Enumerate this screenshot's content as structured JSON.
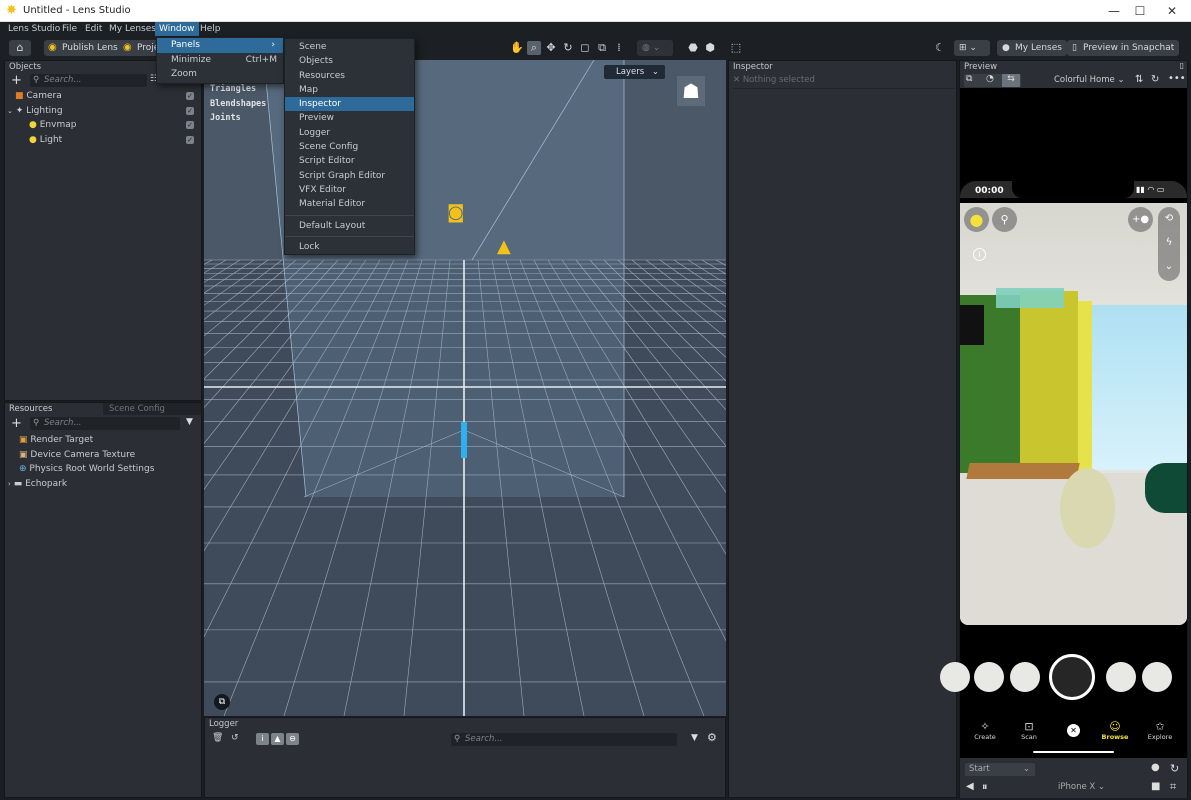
{
  "window": {
    "title": "Untitled - Lens Studio",
    "controls": {
      "minimize": "—",
      "maximize": "☐",
      "close": "✕"
    }
  },
  "menubar": {
    "items": [
      {
        "label": "Lens Studio"
      },
      {
        "label": "File"
      },
      {
        "label": "Edit"
      },
      {
        "label": "My Lenses"
      },
      {
        "label": "Window",
        "active": true
      },
      {
        "label": "Help"
      }
    ]
  },
  "window_menu": {
    "items": [
      {
        "label": "Panels",
        "has_submenu": true,
        "highlighted": true
      },
      {
        "label": "Minimize",
        "shortcut": "Ctrl+M"
      },
      {
        "label": "Zoom"
      }
    ]
  },
  "panels_submenu": {
    "items": [
      "Scene",
      "Objects",
      "Resources",
      "Map",
      "Inspector",
      "Preview",
      "Logger",
      "Scene Config",
      "Script Editor",
      "Script Graph Editor",
      "VFX Editor",
      "Material Editor"
    ],
    "highlighted": "Inspector",
    "extra": [
      "Default Layout",
      "Lock"
    ]
  },
  "toolbar": {
    "home": "⌂",
    "publish_label": "Publish Lens",
    "project_label": "Project Info",
    "my_lenses_label": "My Lenses",
    "preview_snapchat_label": "Preview in Snapchat",
    "tools": [
      "hand-tool",
      "select-tool",
      "move-tool",
      "rotate-tool",
      "scale-tool",
      "rect-tool",
      "grid-tool"
    ]
  },
  "objects_panel": {
    "title": "Objects",
    "search_placeholder": "Search...",
    "items": [
      {
        "label": "Camera",
        "icon": "camera-icon",
        "level": 0,
        "checked": true
      },
      {
        "label": "Lighting",
        "icon": "lighting-icon",
        "level": 0,
        "checked": true,
        "expanded": true
      },
      {
        "label": "Envmap",
        "icon": "bulb-icon",
        "level": 1,
        "checked": true
      },
      {
        "label": "Light",
        "icon": "bulb-icon",
        "level": 1,
        "checked": true
      }
    ]
  },
  "resources_panel": {
    "tabs": [
      "Resources",
      "Scene Config"
    ],
    "active_tab": "Resources",
    "search_placeholder": "Search...",
    "items": [
      {
        "label": "Render Target",
        "icon": "render-target-icon"
      },
      {
        "label": "Device Camera Texture",
        "icon": "camera-texture-icon"
      },
      {
        "label": "Physics Root World Settings",
        "icon": "physics-icon"
      },
      {
        "label": "Echopark",
        "icon": "folder-icon",
        "collapsed": true
      }
    ]
  },
  "viewport": {
    "stats": [
      "Triangles",
      "Blendshapes",
      "Joints"
    ],
    "layers_label": "Layers"
  },
  "logger": {
    "title": "Logger",
    "search_placeholder": "Search..."
  },
  "inspector": {
    "title": "Inspector",
    "empty_text": "Nothing selected"
  },
  "preview": {
    "title": "Preview",
    "scene_select": "Colorful Home",
    "status_time": "00:00",
    "nav": [
      {
        "label": "Create"
      },
      {
        "label": "Scan"
      },
      {
        "label": ""
      },
      {
        "label": "Browse",
        "active": true
      },
      {
        "label": "Explore"
      }
    ],
    "start_select": "Start",
    "device_select": "iPhone X",
    "accent": "#f5e13a"
  }
}
